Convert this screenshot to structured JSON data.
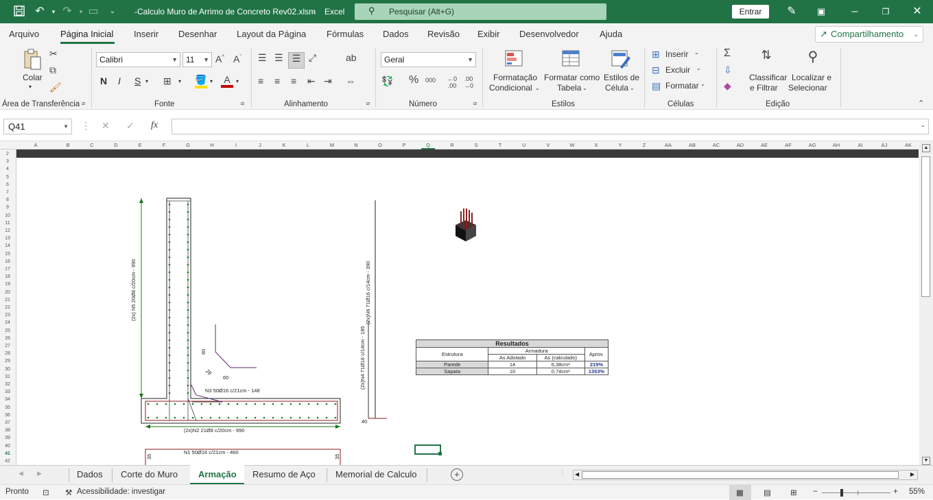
{
  "titlebar": {
    "filename": "-Calculo Muro de Arrimo de Concreto Rev02.xlsm",
    "separator": "-",
    "app": "Excel",
    "search_placeholder": "Pesquisar (Alt+G)",
    "signin": "Entrar",
    "bg_color": "#217346"
  },
  "menu": {
    "items": [
      "Arquivo",
      "Página Inicial",
      "Inserir",
      "Desenhar",
      "Layout da Página",
      "Fórmulas",
      "Dados",
      "Revisão",
      "Exibir",
      "Desenvolvedor",
      "Ajuda"
    ],
    "active": "Página Inicial",
    "share": "Compartilhamento"
  },
  "ribbon": {
    "clipboard": {
      "paste": "Colar",
      "group": "Área de Transferência"
    },
    "font": {
      "name": "Calibri",
      "size": "11",
      "group": "Fonte",
      "bold": "N",
      "italic": "I",
      "underline": "S"
    },
    "alignment": {
      "group": "Alinhamento"
    },
    "number": {
      "format": "Geral",
      "group": "Número"
    },
    "styles": {
      "cond1": "Formatação",
      "cond2": "Condicional",
      "table1": "Formatar como",
      "table2": "Tabela",
      "cell1": "Estilos de",
      "cell2": "Célula",
      "group": "Estilos"
    },
    "cells": {
      "insert": "Inserir",
      "delete": "Excluir",
      "format": "Formatar",
      "group": "Células"
    },
    "editing": {
      "sort1": "Classificar",
      "sort2": "e Filtrar",
      "find1": "Localizar e",
      "find2": "Selecionar",
      "group": "Edição"
    }
  },
  "formula_bar": {
    "name_box": "Q41",
    "formula": "",
    "fx": "fx"
  },
  "columns": [
    "A",
    "B",
    "C",
    "D",
    "E",
    "F",
    "G",
    "H",
    "I",
    "J",
    "K",
    "L",
    "M",
    "N",
    "O",
    "P",
    "Q",
    "R",
    "S",
    "T",
    "U",
    "V",
    "W",
    "X",
    "Y",
    "Z",
    "AA",
    "AB",
    "AC",
    "AD",
    "AE",
    "AF",
    "AG",
    "AH",
    "AI",
    "AJ",
    "AK"
  ],
  "rows": [
    "2",
    "3",
    "4",
    "5",
    "6",
    "7",
    "8",
    "9",
    "10",
    "11",
    "12",
    "13",
    "14",
    "15",
    "16",
    "17",
    "18",
    "19",
    "20",
    "21",
    "22",
    "23",
    "24",
    "25",
    "26",
    "27",
    "28",
    "29",
    "30",
    "31",
    "32",
    "33",
    "34",
    "35",
    "36",
    "37",
    "38",
    "39",
    "40",
    "41",
    "42"
  ],
  "drawing": {
    "label_n5": "(2x) N5 20Ø8 c/20cm - 990",
    "label_n6": "(2x)N6 71Ø16 c/14cm - 390",
    "label_n4": "(2x)N4 71Ø16 c/14cm - 185",
    "label_n3": "N3 50Ø16 c/21cm - 148",
    "label_n2": "(2x)N2 21Ø8 c/20cm - 990",
    "label_n1": "N1 50Ø16 c/21cm - 460",
    "dim_60a": "60",
    "dim_28": "28",
    "dim_60b": "60",
    "dim_40": "40",
    "dim_35a": "35",
    "dim_35b": "35"
  },
  "results": {
    "title": "Resultados",
    "h_structure": "Estrutura",
    "h_reinforcement": "Armadura",
    "h_adopted": "As Adotado",
    "h_calculated": "As (calculado)",
    "h_usage": "Aprov.",
    "rows": [
      {
        "structure": "Parede",
        "adopted": "14",
        "calculated": "6,38cm²",
        "usage": "219%"
      },
      {
        "structure": "Sapata",
        "adopted": "10",
        "calculated": "0,74cm²",
        "usage": "1353%"
      }
    ]
  },
  "sheets": {
    "tabs": [
      "Dados",
      "Corte do Muro",
      "Armação",
      "Resumo de Aço",
      "Memorial de Calculo"
    ],
    "active": "Armação"
  },
  "status": {
    "ready": "Pronto",
    "accessibility": "Acessibilidade: investigar",
    "zoom": "55%"
  }
}
